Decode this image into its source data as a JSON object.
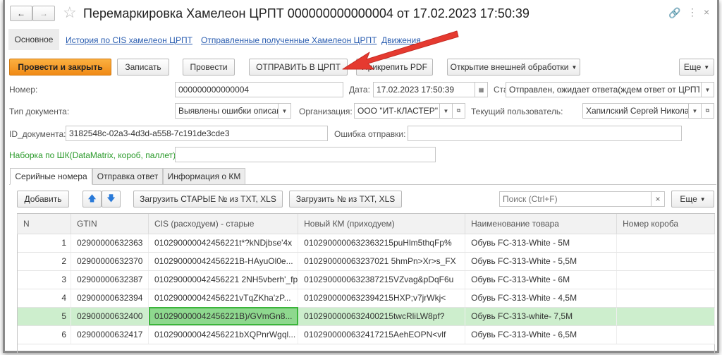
{
  "title": "Перемаркировка Хамелеон ЦРПТ 000000000000004 от 17.02.2023 17:50:39",
  "nav_tabs": {
    "main": "Основное",
    "history": "История по CIS хамелеон ЦРПТ",
    "sent": "Отправленные полученные Хамелеон ЦРПТ",
    "moves": "Движения"
  },
  "toolbar": {
    "post_close": "Провести и закрыть",
    "save": "Записать",
    "post": "Провести",
    "send": "ОТПРАВИТЬ В ЦРПТ",
    "attach_pdf": "Прикрепить PDF",
    "external": "Открытие внешней обработки",
    "more": "Еще"
  },
  "form": {
    "number_label": "Номер:",
    "number": "000000000000004",
    "date_label": "Дата:",
    "date": "17.02.2023 17:50:39",
    "status_label": "Статус:",
    "status": "Отправлен, ожидает ответа(ждем ответ от ЦРПТ)",
    "doctype_label": "Тип документа:",
    "doctype": "Выявлены ошибки описания",
    "org_label": "Организация:",
    "org": "ООО \"ИТ-КЛАСТЕР\"",
    "user_label": "Текущий пользователь:",
    "user": "Хапилский Сергей Николаевич",
    "id_label": "ID_документа:",
    "id": "3182548c-02a3-4d3d-a558-7c191de3cde3",
    "error_label": "Ошибка отправки:",
    "error": "",
    "scan_label": "Наборка по ШК(DataMatrix, короб, паллет):",
    "scan": ""
  },
  "tabs": [
    "Серийные номера",
    "Отправка ответ",
    "Информация о КМ"
  ],
  "table_toolbar": {
    "add": "Добавить",
    "load_old": "Загрузить СТАРЫЕ № из TXT, XLS",
    "load": "Загрузить № из TXT, XLS",
    "search_placeholder": "Поиск (Ctrl+F)",
    "clear": "×",
    "more": "Еще"
  },
  "table": {
    "headers": [
      "N",
      "GTIN",
      "CIS (расходуем) - старые",
      "Новый КМ (приходуем)",
      "Наименование товара",
      "Номер короба"
    ],
    "rows": [
      [
        "1",
        "02900000632363",
        "010290000042456221t*?kNDjbse'4x",
        "0102900000632363215puHlm5thqFp%",
        "Обувь FC-313-White - 5M",
        ""
      ],
      [
        "2",
        "02900000632370",
        "010290000042456221B-HAyuOl0e...",
        "010290000063237021 5hmPn>Xr>s_FX",
        "Обувь FC-313-White - 5,5M",
        ""
      ],
      [
        "3",
        "02900000632387",
        "010290000042456221 2NH5vberh'_fp",
        "0102900000632387215VZvag&pDqF6u",
        "Обувь FC-313-White - 6M",
        ""
      ],
      [
        "4",
        "02900000632394",
        "010290000042456221vTqZKha'zP...",
        "0102900000632394215HXP;v7jrWkj<",
        "Обувь FC-313-White - 4,5M",
        ""
      ],
      [
        "5",
        "02900000632400",
        "010290000042456221B)/GVmGn8...",
        "0102900000632400215twcRliLW8pf?",
        "Обувь FC-313-white- 7,5M",
        ""
      ],
      [
        "6",
        "02900000632417",
        "010290000042456221bXQPnrWgql...",
        "0102900000632417215AehEOPN<vlf",
        "Обувь FC-313-White - 6,5M",
        ""
      ]
    ]
  }
}
